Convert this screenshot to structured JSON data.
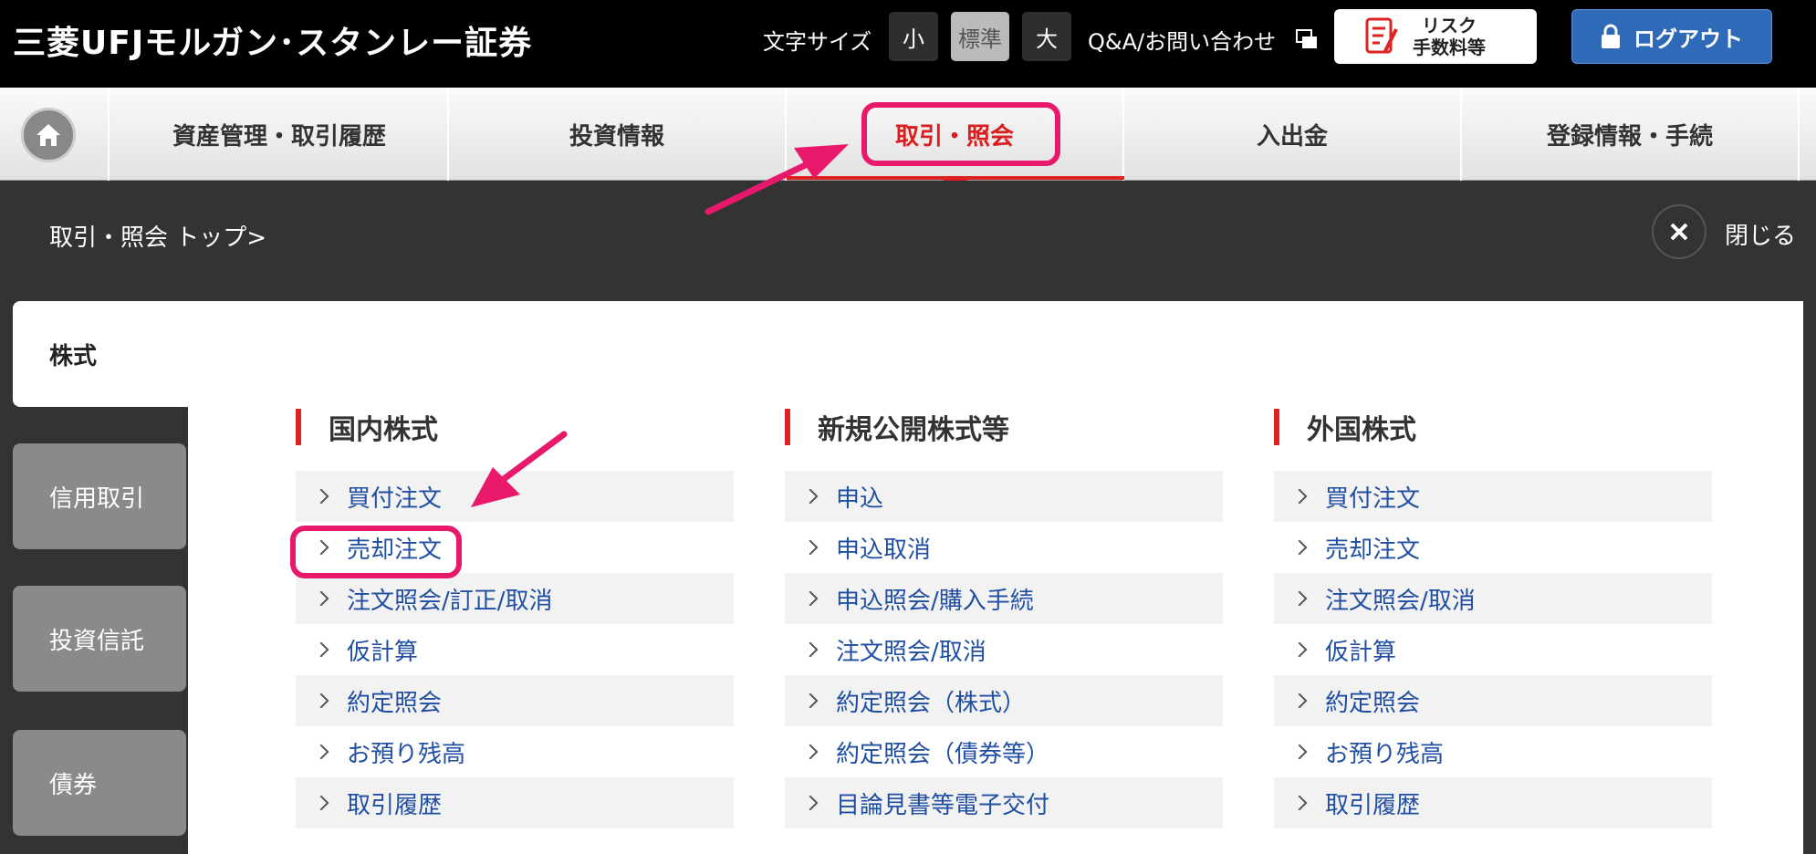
{
  "header": {
    "logo": "三菱UFJモルガン･スタンレー証券",
    "font_size_label": "文字サイズ",
    "font_sizes": [
      "小",
      "標準",
      "大"
    ],
    "qa_link": "Q&A/お問い合わせ",
    "risk_button": {
      "line1": "リスク",
      "line2": "手数料等"
    },
    "logout": "ログアウト"
  },
  "nav": {
    "items": [
      "資産管理・取引履歴",
      "投資情報",
      "取引・照会",
      "入出金",
      "登録情報・手続"
    ],
    "active": "取引・照会"
  },
  "panel": {
    "breadcrumb": "取引・照会 トップ>",
    "close_label": "閉じる"
  },
  "tabs": [
    "株式",
    "信用取引",
    "投資信託",
    "債券"
  ],
  "columns": [
    {
      "title": "国内株式",
      "items": [
        "買付注文",
        "売却注文",
        "注文照会/訂正/取消",
        "仮計算",
        "約定照会",
        "お預り残高",
        "取引履歴"
      ]
    },
    {
      "title": "新規公開株式等",
      "items": [
        "申込",
        "申込取消",
        "申込照会/購入手続",
        "注文照会/取消",
        "約定照会（株式）",
        "約定照会（債券等）",
        "目論見書等電子交付"
      ]
    },
    {
      "title": "外国株式",
      "items": [
        "買付注文",
        "売却注文",
        "注文照会/取消",
        "仮計算",
        "約定照会",
        "お預り残高",
        "取引履歴"
      ]
    }
  ],
  "colors": {
    "accent_red": "#d22222",
    "highlight_pink": "#e8196b",
    "link_blue": "#1f4ea3",
    "logout_blue": "#2f6ab8"
  }
}
